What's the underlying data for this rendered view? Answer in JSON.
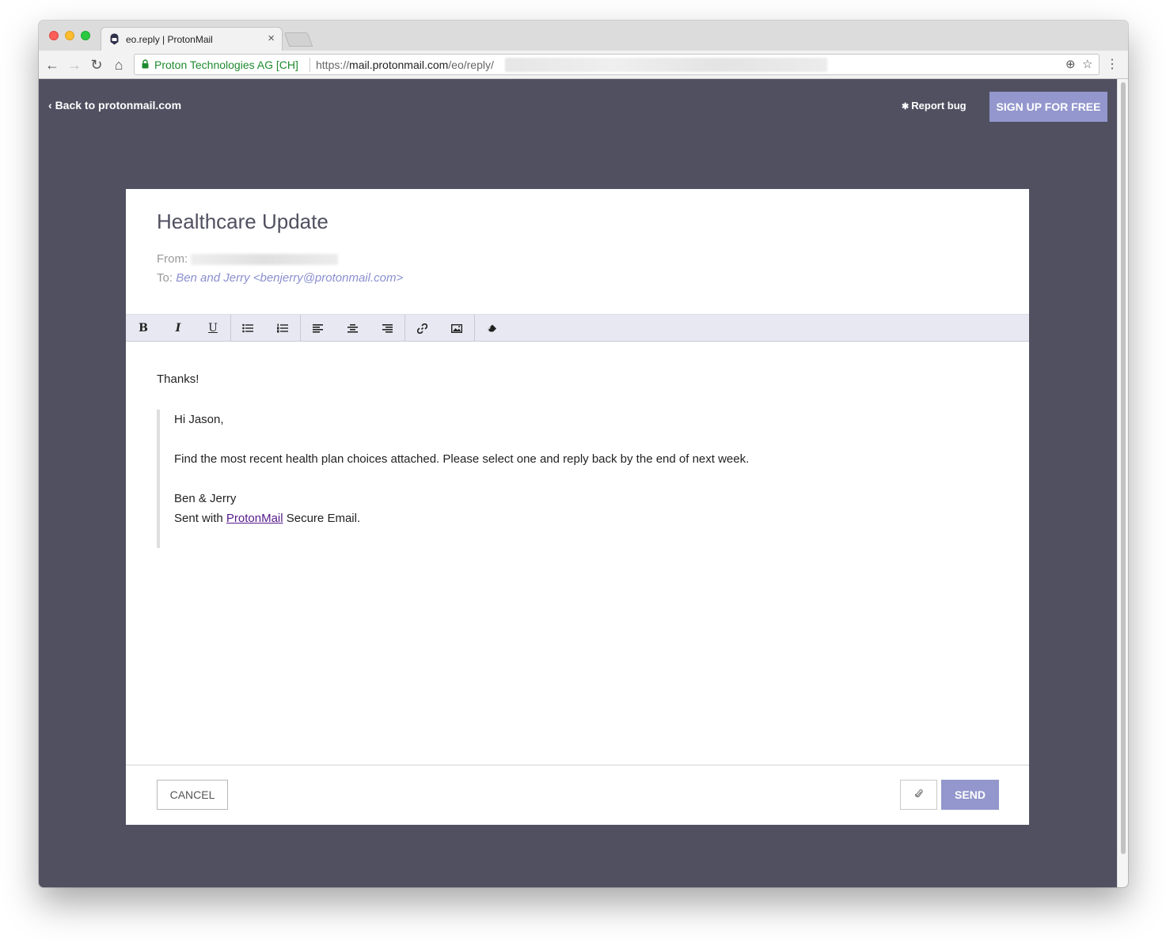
{
  "browser": {
    "tab_title": "eo.reply | ProtonMail",
    "secure_label": "Proton Technologies AG [CH]",
    "url_scheme": "https://",
    "url_host": "mail.protonmail.com",
    "url_path": "/eo/reply/"
  },
  "header": {
    "back_link": "Back to protonmail.com",
    "report_bug": "Report bug",
    "signup_button": "SIGN UP FOR FREE"
  },
  "message": {
    "subject": "Healthcare Update",
    "from_label": "From:",
    "to_label": "To:",
    "to_value": "Ben and Jerry <benjerry@protonmail.com>"
  },
  "editor": {
    "toolbar": [
      {
        "name": "bold-button",
        "label": "B"
      },
      {
        "name": "italic-button",
        "label": "I"
      },
      {
        "name": "underline-button",
        "label": "U"
      },
      {
        "name": "bullet-list-button",
        "icon": "bullet-list-icon"
      },
      {
        "name": "numbered-list-button",
        "icon": "numbered-list-icon"
      },
      {
        "name": "align-left-button",
        "icon": "align-left-icon"
      },
      {
        "name": "align-center-button",
        "icon": "align-center-icon"
      },
      {
        "name": "align-right-button",
        "icon": "align-right-icon"
      },
      {
        "name": "link-button",
        "icon": "link-icon"
      },
      {
        "name": "image-button",
        "icon": "image-icon"
      },
      {
        "name": "clear-format-button",
        "icon": "eraser-icon"
      }
    ],
    "reply_text": "Thanks!",
    "quote": {
      "greeting": "Hi Jason,",
      "body": "Find the most recent health plan choices attached. Please select one and reply back by the end of next week.",
      "signature_name": "Ben & Jerry",
      "sent_with_prefix": "Sent with ",
      "sent_with_link": "ProtonMail",
      "sent_with_suffix": " Secure Email."
    }
  },
  "footer": {
    "cancel_button": "CANCEL",
    "attach_icon": "paperclip-icon",
    "send_button": "SEND"
  },
  "colors": {
    "page_background": "#505061",
    "accent": "#9397cd",
    "recipient": "#8a8fcf"
  }
}
